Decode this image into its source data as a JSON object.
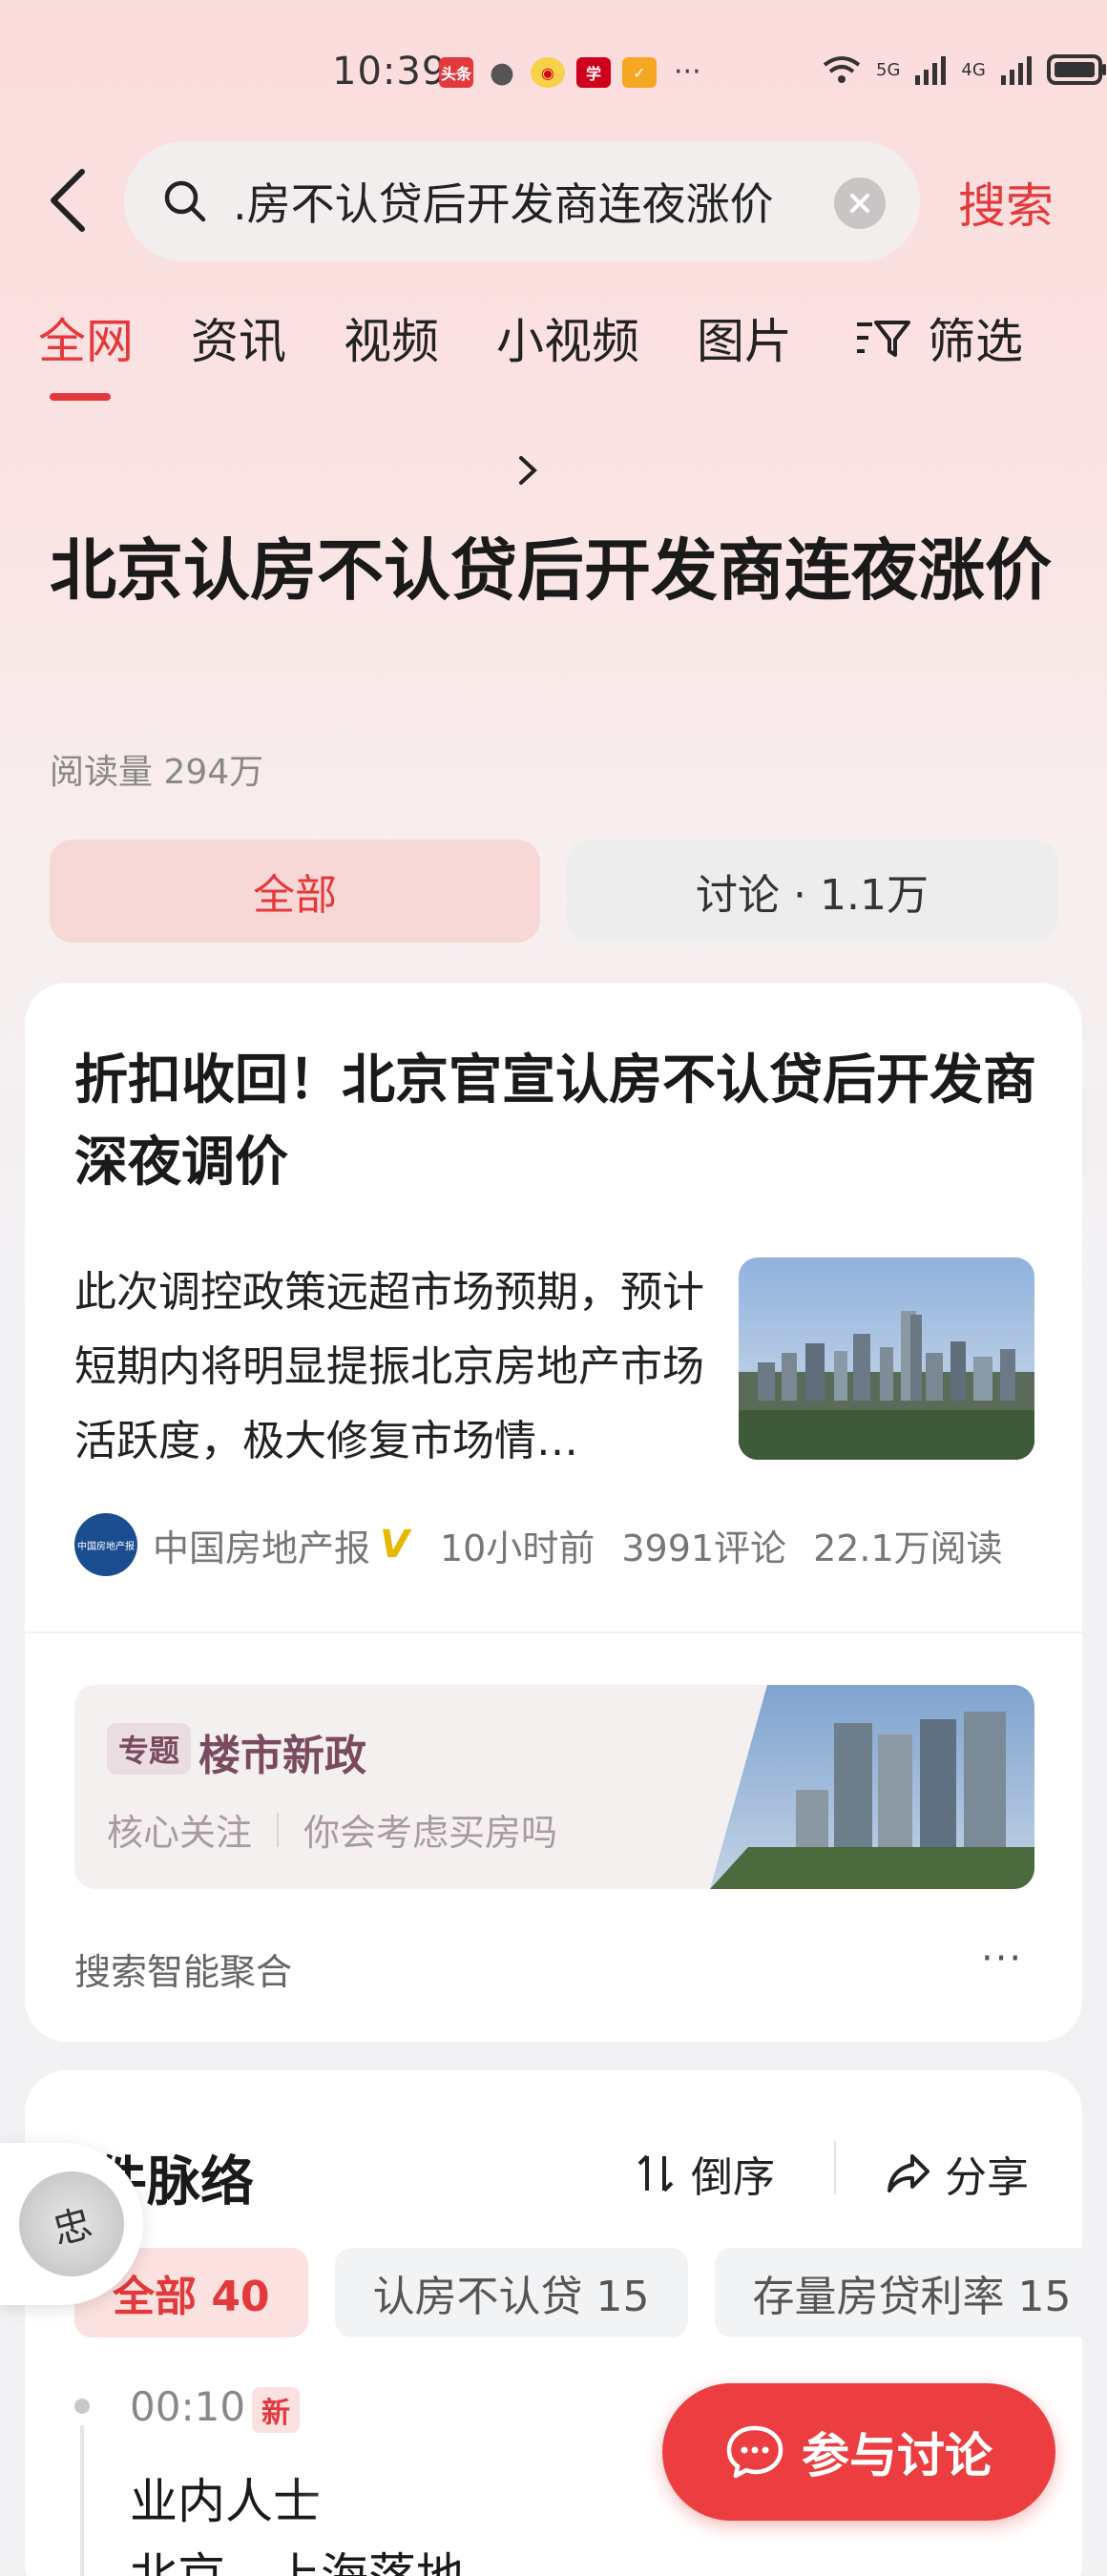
{
  "status_bar": {
    "time": "10:39",
    "apps": [
      {
        "icon": "toutiao-icon",
        "text": "头条",
        "color": "#e4393c"
      },
      {
        "icon": "wechat-icon",
        "text": "●",
        "color": "#555555"
      },
      {
        "icon": "weibo-icon",
        "text": "◉",
        "color": "#e6a000"
      },
      {
        "icon": "xuexi-icon",
        "text": "学",
        "color": "#d0021b"
      },
      {
        "icon": "app-icon",
        "text": "✓",
        "color": "#f5a623"
      }
    ],
    "more": "···",
    "signal1": "5G",
    "signal2": "4G"
  },
  "search": {
    "query": ".房不认贷后开发商连夜涨价",
    "submit_label": "搜索"
  },
  "tabs": [
    "全网",
    "资讯",
    "视频",
    "小视频",
    "图片"
  ],
  "active_tab": "全网",
  "filter_label": "筛选",
  "headline": {
    "title": "北京认房不认贷后开发商连夜涨价",
    "read_count": "阅读量 294万"
  },
  "segments": {
    "all": "全部",
    "discussion": "讨论 · 1.1万"
  },
  "article": {
    "title": "折扣收回！北京官宣认房不认贷后开发商深夜调价",
    "summary": "此次调控政策远超市场预期，预计短期内将明显提振北京房地产市场活跃度，极大修复市场情…",
    "source": "中国房地产报",
    "verified_mark": "V",
    "time": "10小时前",
    "comments": "3991评论",
    "reads": "22.1万阅读"
  },
  "topic": {
    "tag": "专题",
    "title": "楼市新政",
    "links": [
      "核心关注",
      "你会考虑买房吗"
    ]
  },
  "aggregate_label": "搜索智能聚合",
  "more_label": "···",
  "timeline": {
    "title": "事件脉络",
    "title_visible": "件脉络",
    "sort_label": "倒序",
    "share_label": "分享",
    "chips": [
      "全部 40",
      "认房不认贷 15",
      "存量房贷利率 15"
    ],
    "items": [
      {
        "time": "00:10",
        "badge": "新",
        "line1": "业内人士",
        "line2": "北京、上海落地"
      }
    ]
  },
  "floating_avatar_text": "忠",
  "join_button": "参与讨论",
  "colors": {
    "accent": "#e4393c",
    "topic": "#7a4a5f"
  }
}
